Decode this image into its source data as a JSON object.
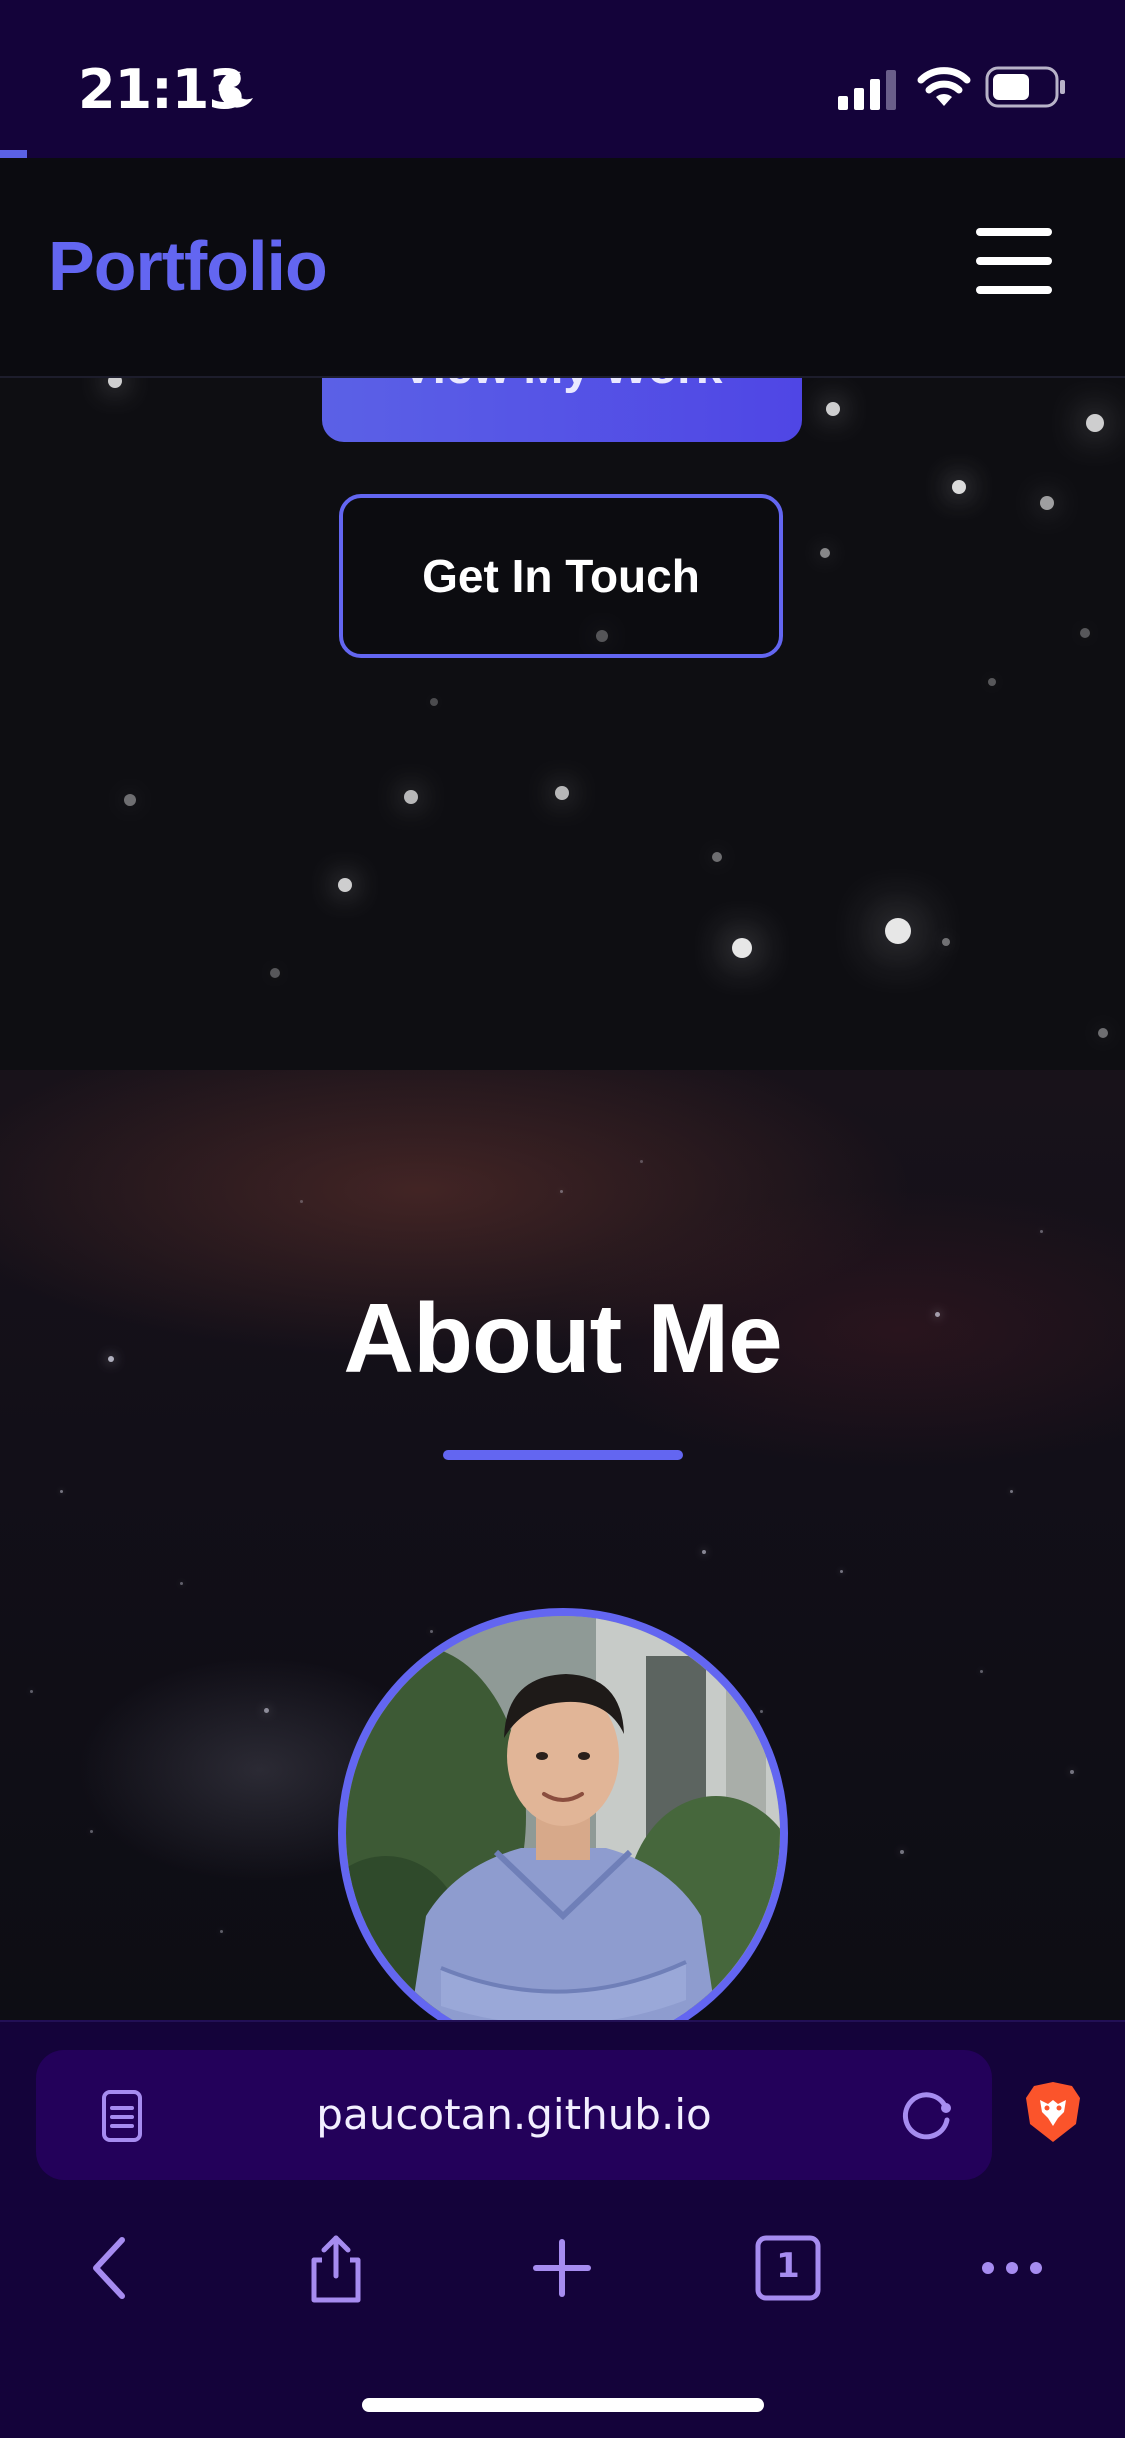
{
  "status_bar": {
    "time": "21:13",
    "icons": [
      "moon-icon",
      "signal-icon",
      "wifi-icon",
      "battery-icon"
    ]
  },
  "scroll_progress": 0.024,
  "nav": {
    "brand": "Portfolio",
    "menu_icon": "hamburger-menu-icon"
  },
  "hero": {
    "primary_button": "View My Work",
    "secondary_button": "Get In Touch"
  },
  "about": {
    "title": "About Me",
    "photo_icon": "profile-photo"
  },
  "browser": {
    "url": "paucotan.github.io",
    "tab_count": "1",
    "toolbar": [
      "back-icon",
      "share-icon",
      "new-tab-icon",
      "tabs-icon",
      "more-icon"
    ]
  },
  "colors": {
    "accent": "#6366f1",
    "browser_bg": "#14033a",
    "url_field_bg": "#23015a",
    "page_bg": "#0e0e12"
  }
}
